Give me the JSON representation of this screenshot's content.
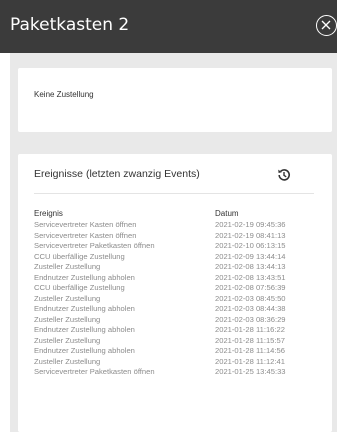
{
  "header": {
    "title": "Paketkasten 2"
  },
  "status": {
    "text": "Keine Zustellung"
  },
  "events": {
    "title": "Ereignisse (letzten zwanzig Events)",
    "columns": {
      "event": "Ereignis",
      "date": "Datum"
    },
    "rows": [
      {
        "event": "Servicevertreter Kasten öffnen",
        "date": "2021-02-19 09:45:36"
      },
      {
        "event": "Servicevertreter Kasten öffnen",
        "date": "2021-02-19 08:41:13"
      },
      {
        "event": "Servicevertreter Paketkasten öffnen",
        "date": "2021-02-10 06:13:15"
      },
      {
        "event": "CCU überfällige Zustellung",
        "date": "2021-02-09 13:44:14"
      },
      {
        "event": "Zusteller Zustellung",
        "date": "2021-02-08 13:44:13"
      },
      {
        "event": "Endnutzer Zustellung abholen",
        "date": "2021-02-08 13:43:51"
      },
      {
        "event": "CCU überfällige Zustellung",
        "date": "2021-02-08 07:56:39"
      },
      {
        "event": "Zusteller Zustellung",
        "date": "2021-02-03 08:45:50"
      },
      {
        "event": "Endnutzer Zustellung abholen",
        "date": "2021-02-03 08:44:38"
      },
      {
        "event": "Zusteller Zustellung",
        "date": "2021-02-03 08:36:29"
      },
      {
        "event": "Endnutzer Zustellung abholen",
        "date": "2021-01-28 11:16:22"
      },
      {
        "event": "Zusteller Zustellung",
        "date": "2021-01-28 11:15:57"
      },
      {
        "event": "Endnutzer Zustellung abholen",
        "date": "2021-01-28 11:14:56"
      },
      {
        "event": "Zusteller Zustellung",
        "date": "2021-01-28 11:12:41"
      },
      {
        "event": "Servicevertreter Paketkasten öffnen",
        "date": "2021-01-25 13:45:33"
      }
    ]
  },
  "icons": {
    "close": "close-circle-icon",
    "history": "history-icon"
  },
  "colors": {
    "header_bg": "#3b3b3b",
    "panel_bg": "#e9e9e9",
    "card_bg": "#ffffff",
    "muted_text": "#8c8c8c"
  }
}
